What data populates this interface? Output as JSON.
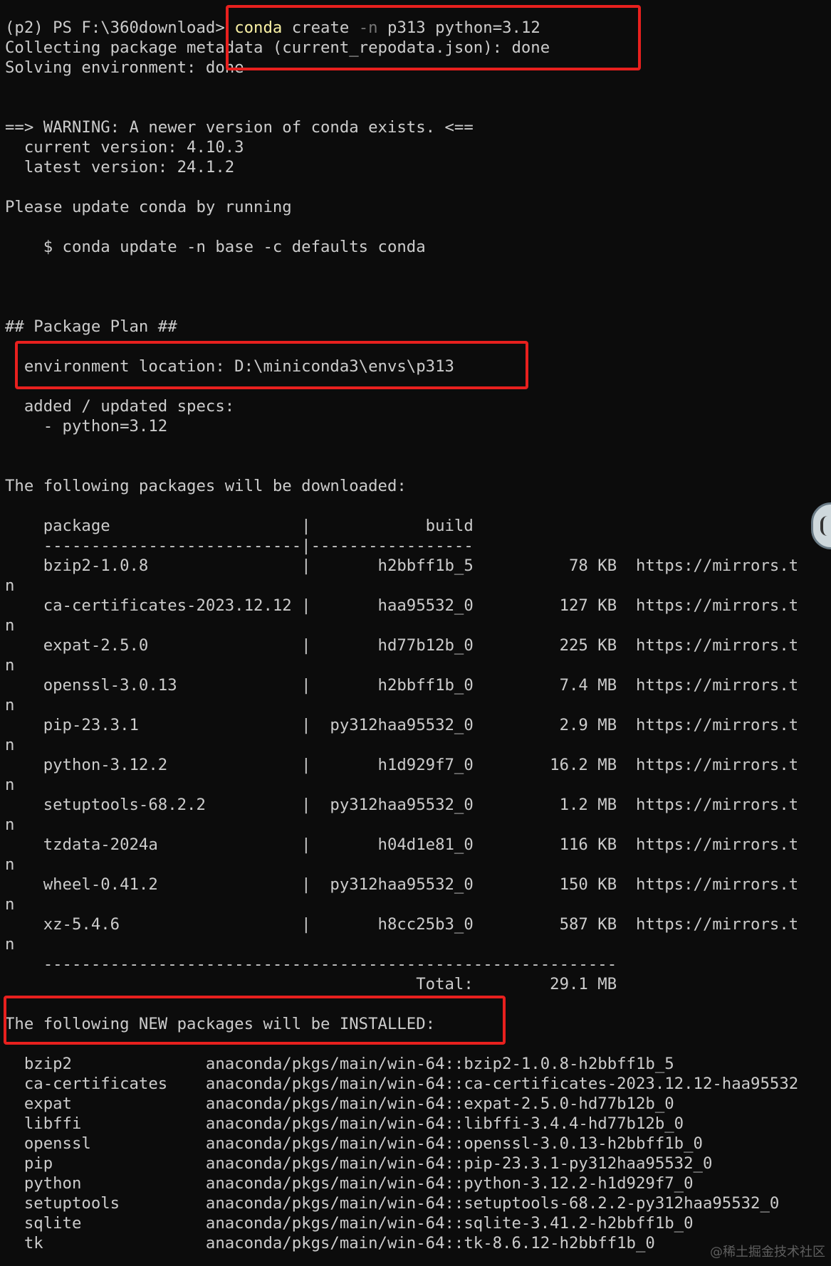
{
  "terminal": {
    "prompt": "(p2) PS F:\\360download>",
    "cmd_name": "conda",
    "cmd_sub": "create",
    "cmd_flag": "-n",
    "cmd_args": "p313 python=3.12",
    "collecting": "Collecting package metadata (current_repodata.json): done",
    "solving": "Solving environment: done",
    "warning_line": "==> WARNING: A newer version of conda exists. <==",
    "current_version": "  current version: 4.10.3",
    "latest_version": "  latest version: 24.1.2",
    "please_update": "Please update conda by running",
    "update_cmd": "    $ conda update -n base -c defaults conda",
    "package_plan": "## Package Plan ##",
    "env_location": "  environment location: D:\\miniconda3\\envs\\p313",
    "added_specs": "  added / updated specs:",
    "spec_item": "    - python=3.12",
    "download_heading": "The following packages will be downloaded:",
    "download_table": {
      "header": "    package                    |            build",
      "separator": "    ---------------------------|-----------------",
      "rows": [
        "    bzip2-1.0.8                |       h2bbff1b_5          78 KB  https://mirrors.t",
        "    ca-certificates-2023.12.12 |       haa95532_0         127 KB  https://mirrors.t",
        "    expat-2.5.0                |       hd77b12b_0         225 KB  https://mirrors.t",
        "    openssl-3.0.13             |       h2bbff1b_0         7.4 MB  https://mirrors.t",
        "    pip-23.3.1                 |  py312haa95532_0         2.9 MB  https://mirrors.t",
        "    python-3.12.2              |       h1d929f7_0        16.2 MB  https://mirrors.t",
        "    setuptools-68.2.2          |  py312haa95532_0         1.2 MB  https://mirrors.t",
        "    tzdata-2024a               |       h04d1e81_0         116 KB  https://mirrors.t",
        "    wheel-0.41.2               |  py312haa95532_0         150 KB  https://mirrors.t",
        "    xz-5.4.6                   |       h8cc25b3_0         587 KB  https://mirrors.t"
      ],
      "wrap": "n",
      "footer_sep": "    ------------------------------------------------------------",
      "total": "                                           Total:        29.1 MB"
    },
    "install_heading": "The following NEW packages will be INSTALLED:",
    "install_rows": [
      "  bzip2              anaconda/pkgs/main/win-64::bzip2-1.0.8-h2bbff1b_5",
      "  ca-certificates    anaconda/pkgs/main/win-64::ca-certificates-2023.12.12-haa95532",
      "  expat              anaconda/pkgs/main/win-64::expat-2.5.0-hd77b12b_0",
      "  libffi             anaconda/pkgs/main/win-64::libffi-3.4.4-hd77b12b_0",
      "  openssl            anaconda/pkgs/main/win-64::openssl-3.0.13-h2bbff1b_0",
      "  pip                anaconda/pkgs/main/win-64::pip-23.3.1-py312haa95532_0",
      "  python             anaconda/pkgs/main/win-64::python-3.12.2-h1d929f7_0",
      "  setuptools         anaconda/pkgs/main/win-64::setuptools-68.2.2-py312haa95532_0",
      "  sqlite             anaconda/pkgs/main/win-64::sqlite-3.41.2-h2bbff1b_0",
      "  tk                 anaconda/pkgs/main/win-64::tk-8.6.12-h2bbff1b_0"
    ],
    "watermark": "@稀土掘金技术社区"
  },
  "colors": {
    "background": "#0c0c0c",
    "text": "#cccccc",
    "command": "#f9f1a5",
    "flag": "#767676",
    "highlight_box": "#e8201e"
  }
}
